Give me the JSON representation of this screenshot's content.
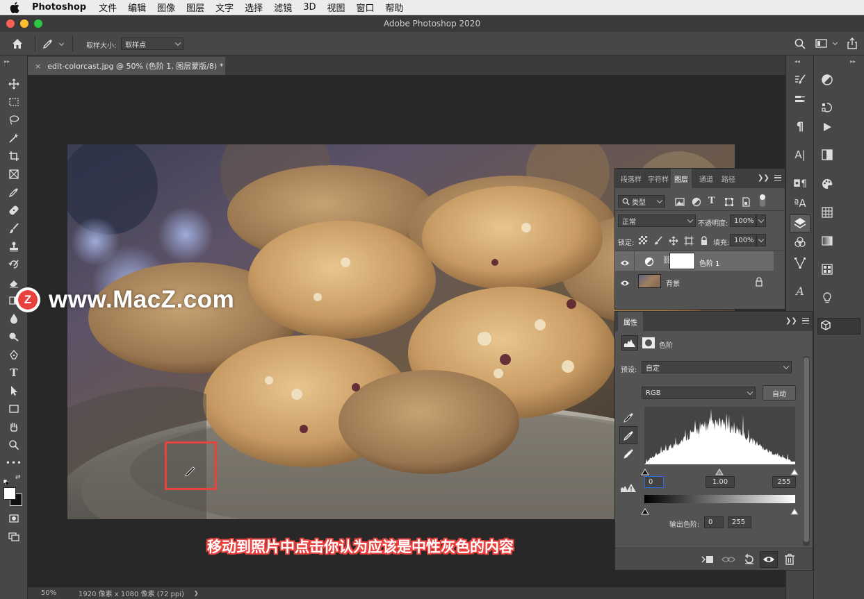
{
  "menubar": {
    "app": "Photoshop",
    "items": [
      "文件",
      "编辑",
      "图像",
      "图层",
      "文字",
      "选择",
      "滤镜",
      "3D",
      "视图",
      "窗口",
      "帮助"
    ]
  },
  "window": {
    "title": "Adobe Photoshop 2020"
  },
  "options": {
    "sample_size_label": "取样大小:",
    "sample_size_value": "取样点"
  },
  "document": {
    "tab_title": "edit-colorcast.jpg @ 50% (色阶 1, 图层蒙版/8) *",
    "zoom": "50%",
    "info": "1920 像素 x 1080 像素 (72 ppi)",
    "info_arrow": "❯"
  },
  "watermark": {
    "badge": "Z",
    "text": "www.MacZ.com"
  },
  "caption": "移动到照片中点击你认为应该是中性灰色的内容",
  "layers_panel": {
    "tabs": [
      "段落样",
      "字符样",
      "图层",
      "通道",
      "路径"
    ],
    "filter_label": "类型",
    "blend_mode": "正常",
    "opacity_label": "不透明度:",
    "opacity_value": "100%",
    "lock_label": "锁定:",
    "fill_label": "填充:",
    "fill_value": "100%",
    "layers": [
      {
        "name": "色阶 1"
      },
      {
        "name": "背景"
      }
    ]
  },
  "properties_panel": {
    "tab": "属性",
    "type_label": "色阶",
    "preset_label": "预设:",
    "preset_value": "自定",
    "channel_value": "RGB",
    "auto_button": "自动",
    "input_black": "0",
    "input_gamma": "1.00",
    "input_white": "255",
    "output_label": "输出色阶:",
    "output_black": "0",
    "output_white": "255"
  },
  "colors": {
    "highlight_box": "#e8423f",
    "caption_text": "#ffffff",
    "caption_outline": "#e8423f",
    "watermark_badge": "#e8423f"
  }
}
